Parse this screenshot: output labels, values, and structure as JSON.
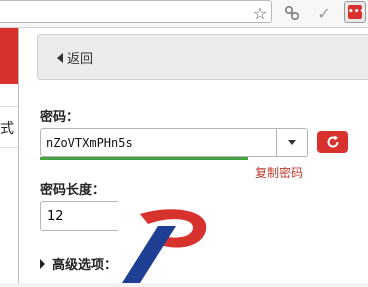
{
  "toolbar": {
    "icons": [
      "star-icon",
      "puzzle-icon",
      "check-icon",
      "extension-icon"
    ],
    "extension_glyph": "•••"
  },
  "background_page": {
    "text_fragment": "式"
  },
  "popup": {
    "back_label": "返回",
    "password_label": "密码：",
    "password_value": "nZoVTXmPHn5s",
    "copy_label": "复制密码",
    "length_label": "密码长度：",
    "length_value": "12",
    "advanced_label": "高级选项："
  },
  "colors": {
    "accent_red": "#d8322f",
    "strength_green": "#46a046",
    "logo_blue": "#1f3f94"
  }
}
